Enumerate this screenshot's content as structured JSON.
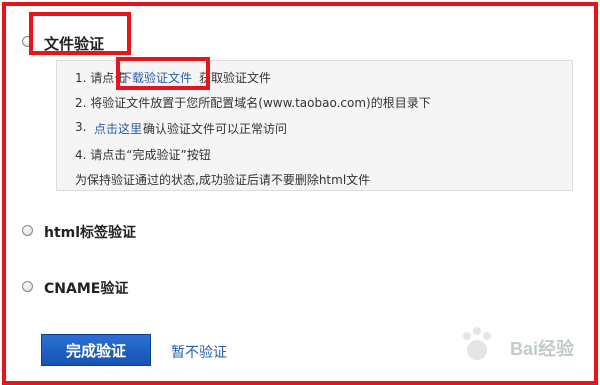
{
  "options": [
    {
      "label": "文件验证"
    },
    {
      "label": "html标签验证"
    },
    {
      "label": "CNAME验证"
    }
  ],
  "file_steps": {
    "s1_prefix": "1. 请点击",
    "s1_link": "下载验证文件",
    "s1_suffix": "获取验证文件",
    "s2": "2. 将验证文件放置于您所配置域名(www.taobao.com)的根目录下",
    "s3_num": "3.",
    "s3_link": "点击这里",
    "s3_suffix": "确认验证文件可以正常访问",
    "s4": "4. 请点击“完成验证”按钮",
    "note": "为保持验证通过的状态,成功验证后请不要删除html文件"
  },
  "actions": {
    "complete": "完成验证",
    "skip": "暂不验证"
  },
  "watermark": "Bai经验",
  "colors": {
    "highlight": "#e8141b",
    "button": "#1f5fc4",
    "link": "#2a5ea8"
  }
}
